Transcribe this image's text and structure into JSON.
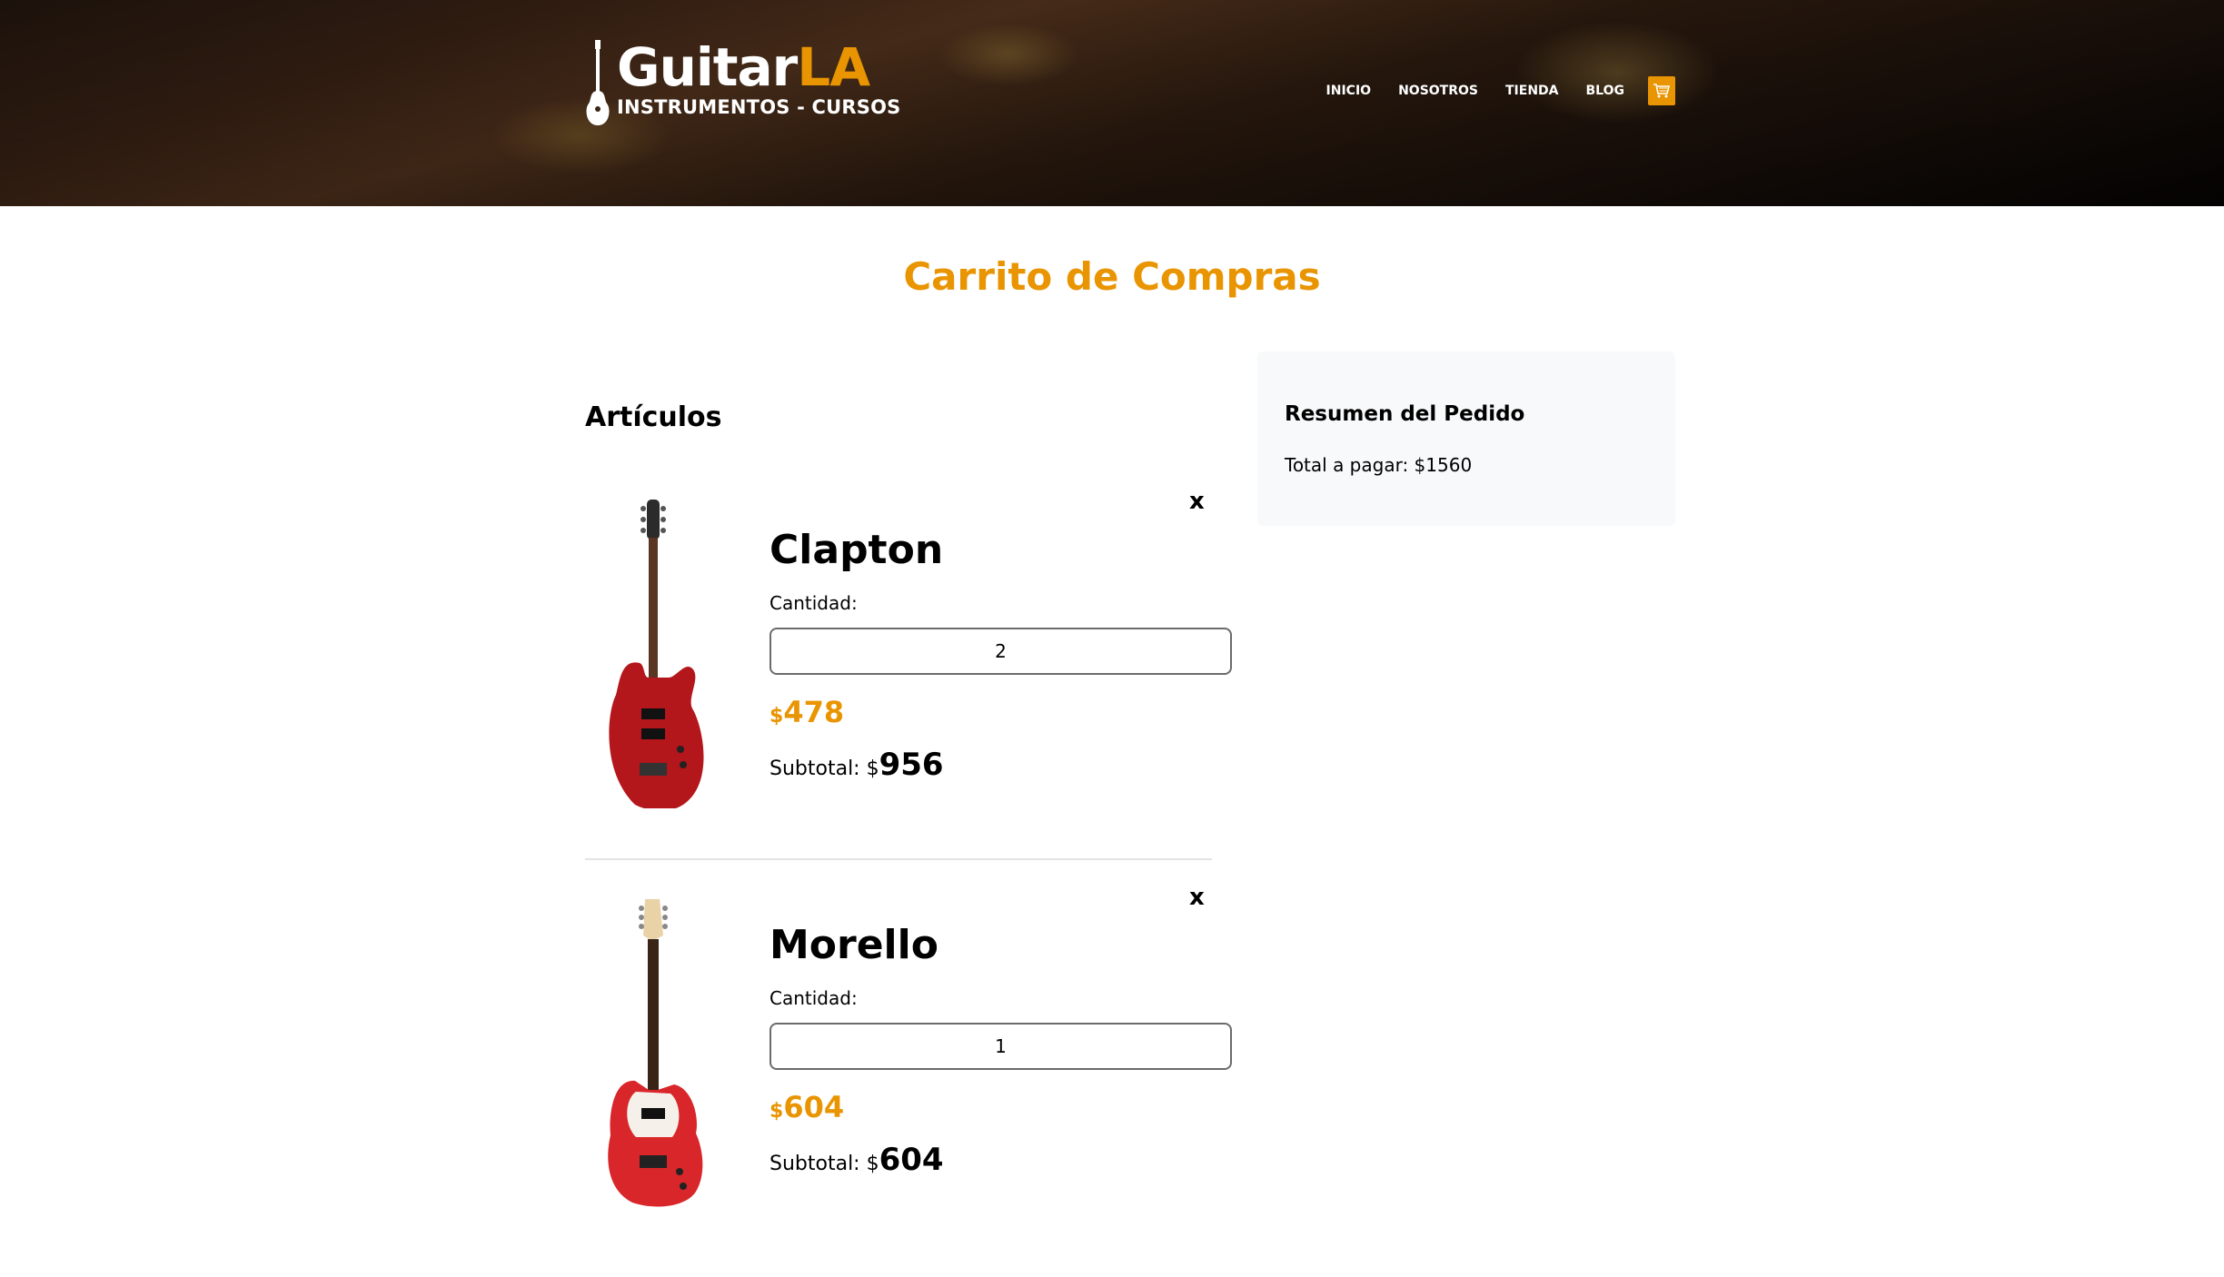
{
  "brand": {
    "name_main": "Guitar",
    "name_accent": "LA",
    "tagline": "INSTRUMENTOS - CURSOS"
  },
  "nav": {
    "items": [
      "INICIO",
      "NOSOTROS",
      "TIENDA",
      "BLOG"
    ]
  },
  "colors": {
    "accent": "#e99401",
    "summary_bg": "#f8f9fa"
  },
  "page": {
    "title": "Carrito de Compras"
  },
  "cart": {
    "section_title": "Artículos",
    "qty_label": "Cantidad:",
    "subtotal_label": "Subtotal: $",
    "currency": "$",
    "remove_label": "x",
    "items": [
      {
        "name": "Clapton",
        "quantity": "2",
        "price": "478",
        "subtotal": "956"
      },
      {
        "name": "Morello",
        "quantity": "1",
        "price": "604",
        "subtotal": "604"
      }
    ]
  },
  "summary": {
    "title": "Resumen del Pedido",
    "total_text": "Total a pagar: $1560"
  }
}
